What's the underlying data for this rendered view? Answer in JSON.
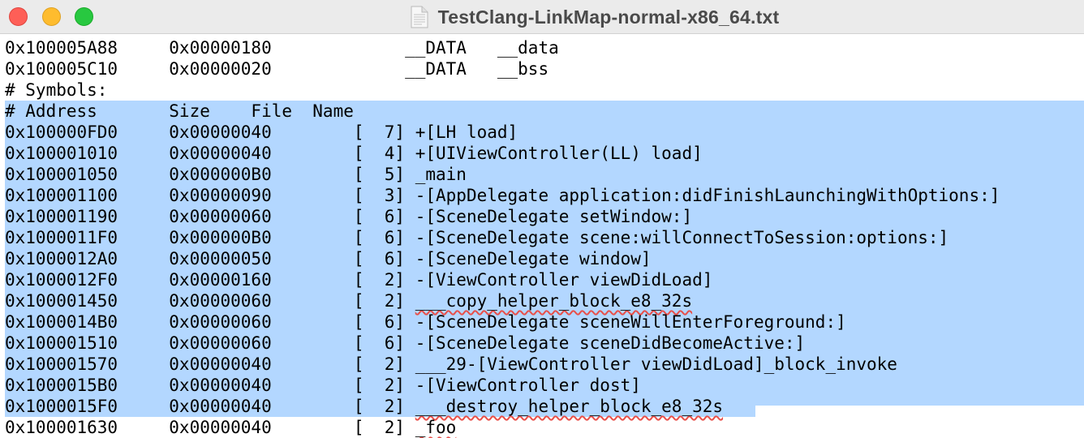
{
  "window": {
    "title": "TestClang-LinkMap-normal-x86_64.txt",
    "icon": "text-document-icon"
  },
  "lines": [
    "0x100005A88\t0x00000180\t__DATA\t__data",
    "0x100005C10\t0x00000020\t__DATA\t__bss",
    "# Symbols:",
    "# Address\tSize    \tFile  Name",
    "0x100000FD0\t0x00000040\t[  7] +[LH load]",
    "0x100001010\t0x00000040\t[  4] +[UIViewController(LL) load]",
    "0x100001050\t0x000000B0\t[  5] _main",
    "0x100001100\t0x00000090\t[  3] -[AppDelegate application:didFinishLaunchingWithOptions:]",
    "0x100001190\t0x00000060\t[  6] -[SceneDelegate setWindow:]",
    "0x1000011F0\t0x000000B0\t[  6] -[SceneDelegate scene:willConnectToSession:options:]",
    "0x1000012A0\t0x00000050\t[  6] -[SceneDelegate window]",
    "0x1000012F0\t0x00000160\t[  2] -[ViewController viewDidLoad]",
    "0x100001450\t0x00000060\t[  2] ___copy_helper_block_e8_32s",
    "0x1000014B0\t0x00000060\t[  6] -[SceneDelegate sceneWillEnterForeground:]",
    "0x100001510\t0x00000060\t[  6] -[SceneDelegate sceneDidBecomeActive:]",
    "0x100001570\t0x00000040\t[  2] ___29-[ViewController viewDidLoad]_block_invoke",
    "0x1000015B0\t0x00000040\t[  2] -[ViewController dost]",
    "0x1000015F0\t0x00000040\t[  2] ___destroy_helper_block_e8_32s",
    "0x100001630\t0x00000040\t[  2] _foo"
  ],
  "selection": {
    "color": "#b3d7ff"
  },
  "colors": {
    "spellcheck_underline": "#e8504a",
    "titlebar": "#ebebeb"
  }
}
